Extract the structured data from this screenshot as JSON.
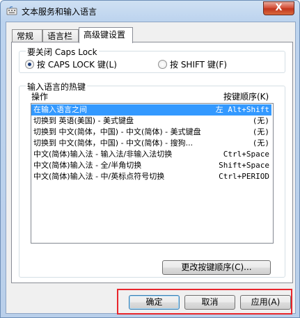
{
  "window": {
    "title": "文本服务和输入语言",
    "close_glyph": "X"
  },
  "tabs": [
    {
      "label": "常规",
      "active": false
    },
    {
      "label": "语言栏",
      "active": false
    },
    {
      "label": "高级键设置",
      "active": true
    }
  ],
  "caps_lock": {
    "label": "要关闭 Caps Lock",
    "options": [
      {
        "label": "按 CAPS LOCK 键(L)",
        "selected": true
      },
      {
        "label": "按 SHIFT 键(F)",
        "selected": false
      }
    ]
  },
  "hotkeys": {
    "label": "输入语言的热键",
    "col_action": "操作",
    "col_sequence": "按键顺序(K)",
    "rows": [
      {
        "action": "在输入语言之间",
        "sequence": "左 Alt+Shift",
        "selected": true
      },
      {
        "action": "切换到 英语(美国) - 美式键盘",
        "sequence": "(无)",
        "selected": false
      },
      {
        "action": "切换到 中文(简体，中国) - 中文(简体) - 美式键盘",
        "sequence": "(无)",
        "selected": false
      },
      {
        "action": "切换到 中文(简体，中国) - 中文(简体) - 搜狗...",
        "sequence": "(无)",
        "selected": false
      },
      {
        "action": "中文(简体)输入法 - 输入法/非输入法切换",
        "sequence": "Ctrl+Space",
        "selected": false
      },
      {
        "action": "中文(简体)输入法 - 全/半角切换",
        "sequence": "Shift+Space",
        "selected": false
      },
      {
        "action": "中文(简体)输入法 - 中/英标点符号切换",
        "sequence": "Ctrl+PERIOD",
        "selected": false
      }
    ],
    "change_button": "更改按键顺序(C)..."
  },
  "buttons": {
    "ok": "确定",
    "cancel": "取消",
    "apply": "应用(A)"
  },
  "colors": {
    "selection": "#3399ff",
    "highlight": "#e8262c"
  }
}
